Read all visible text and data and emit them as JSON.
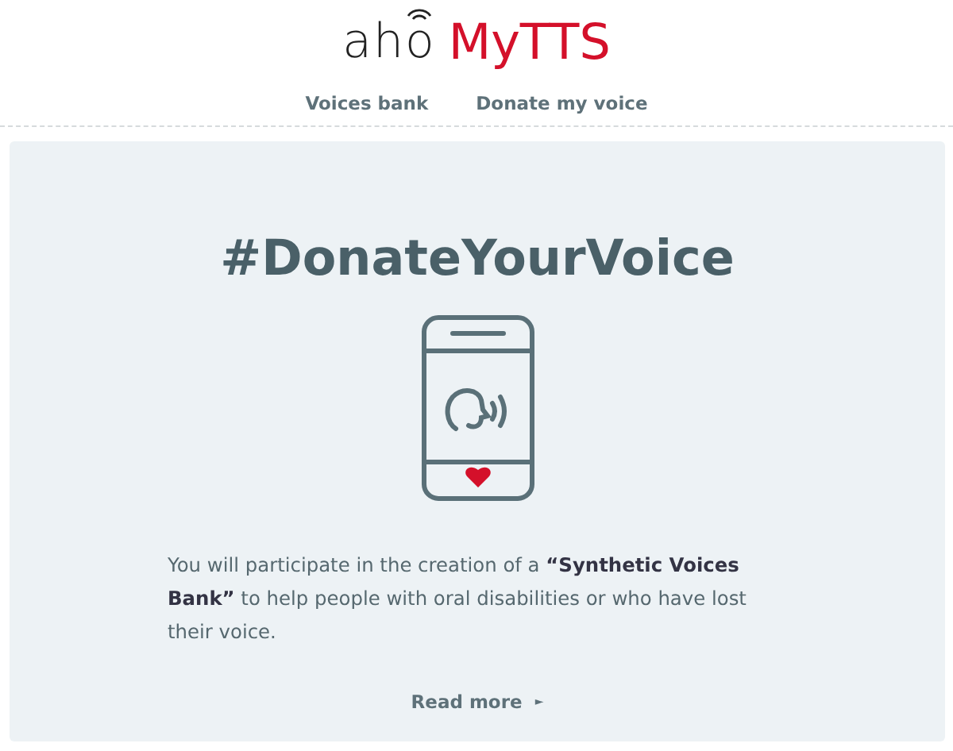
{
  "logo": {
    "prefix": "aho",
    "brand": "MyTTS"
  },
  "nav": [
    {
      "label": "Voices bank"
    },
    {
      "label": "Donate my voice"
    }
  ],
  "hero": {
    "title": "#DonateYourVoice",
    "text": "You will participate in the creation of a **“Synthetic Voices Bank”** to help people with oral disabilities or who have lost their voice.",
    "link": "Read more",
    "link_arrow": "►"
  }
}
